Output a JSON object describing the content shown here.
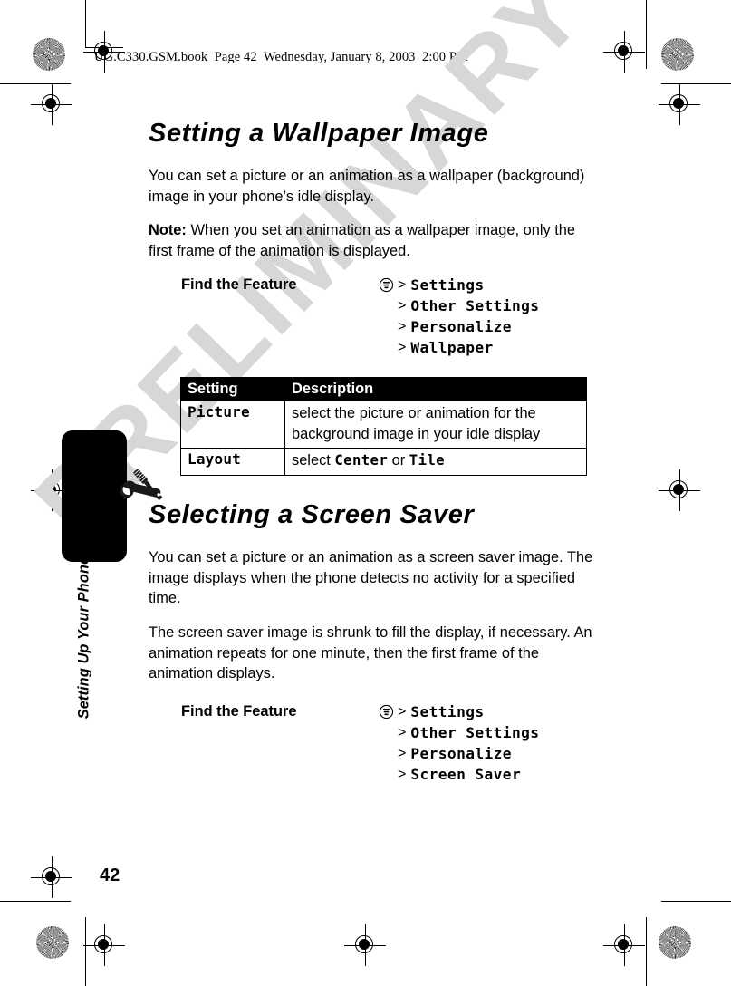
{
  "page": {
    "header_note": "UG.C330.GSM.book  Page 42  Wednesday, January 8, 2003  2:00 PM",
    "number": "42",
    "watermark": "PRELIMINARY",
    "chapter_tab_label": "Setting Up Your Phone",
    "tab_color": "#000000",
    "text_color": "#000000",
    "watermark_color": "#d7d7d7"
  },
  "sections": [
    {
      "title": "Setting a Wallpaper Image",
      "paragraphs": [
        "You can set a picture or an animation as a wallpaper (background) image in your phone’s idle display.",
        "When you set an animation as a wallpaper image, only the first frame of the animation is displayed."
      ],
      "note_label": "Note:",
      "find_the_feature": {
        "label": "Find the Feature",
        "icon": "menu-icon",
        "path": [
          "Settings",
          "Other Settings",
          "Personalize",
          "Wallpaper"
        ],
        "separator": ">"
      },
      "table": {
        "headers": [
          "Setting",
          "Description"
        ],
        "rows": [
          {
            "setting": "Picture",
            "description": "select the picture or animation for the background image in your idle display"
          },
          {
            "setting": "Layout",
            "description_prefix": "select ",
            "option_a": "Center",
            "description_middle": " or ",
            "option_b": "Tile"
          }
        ]
      }
    },
    {
      "title": "Selecting a Screen Saver",
      "paragraphs": [
        "You can set a picture or an animation as a screen saver image. The image displays when the phone detects no activity for a specified time.",
        "The screen saver image is shrunk to fill the display, if necessary. An animation repeats for one minute, then the first frame of the animation displays."
      ],
      "find_the_feature": {
        "label": "Find the Feature",
        "icon": "menu-icon",
        "path": [
          "Settings",
          "Other Settings",
          "Personalize",
          "Screen Saver"
        ],
        "separator": ">"
      }
    }
  ]
}
